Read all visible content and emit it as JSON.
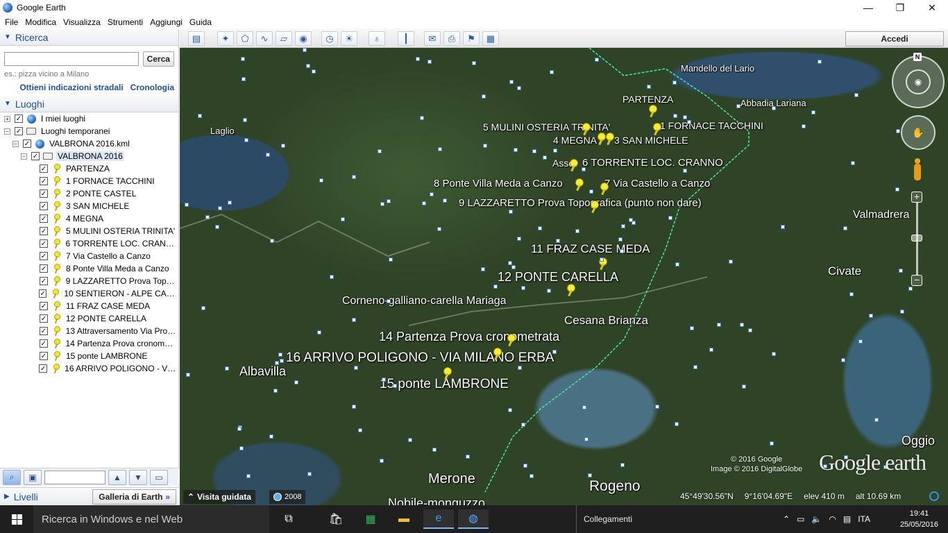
{
  "window": {
    "title": "Google Earth",
    "controls": [
      "—",
      "❐",
      "✕"
    ]
  },
  "menu": [
    "File",
    "Modifica",
    "Visualizza",
    "Strumenti",
    "Aggiungi",
    "Guida"
  ],
  "search": {
    "header": "Ricerca",
    "input_value": "",
    "button": "Cerca",
    "hint": "es.: pizza vicino a Milano",
    "link_directions": "Ottieni indicazioni stradali",
    "link_history": "Cronologia"
  },
  "places": {
    "header": "Luoghi",
    "tree": [
      {
        "label": "I miei luoghi",
        "indent": 0,
        "expander": "+",
        "icon": "globe"
      },
      {
        "label": "Luoghi temporanei",
        "indent": 0,
        "expander": "−",
        "icon": "folder"
      },
      {
        "label": "VALBRONA 2016.kml",
        "indent": 1,
        "expander": "−",
        "icon": "globe"
      },
      {
        "label": "VALBRONA 2016",
        "indent": 2,
        "expander": "−",
        "icon": "folder",
        "selected": true
      },
      {
        "label": "PARTENZA",
        "indent": 3,
        "icon": "pin"
      },
      {
        "label": "1 FORNACE TACCHINI",
        "indent": 3,
        "icon": "pin"
      },
      {
        "label": "2 PONTE CASTEL",
        "indent": 3,
        "icon": "pin"
      },
      {
        "label": "3 SAN MICHELE",
        "indent": 3,
        "icon": "pin"
      },
      {
        "label": "4 MEGNA",
        "indent": 3,
        "icon": "pin"
      },
      {
        "label": "5 MULINI OSTERIA TRINITA'",
        "indent": 3,
        "icon": "pin"
      },
      {
        "label": "6 TORRENTE LOC. CRANNO",
        "indent": 3,
        "icon": "pin"
      },
      {
        "label": "7 Via Castello a Canzo",
        "indent": 3,
        "icon": "pin"
      },
      {
        "label": "8 Ponte Villa Meda a Canzo",
        "indent": 3,
        "icon": "pin"
      },
      {
        "label": "9 LAZZARETTO Prova Topo...",
        "indent": 3,
        "icon": "pin"
      },
      {
        "label": "10 SENTIERON - ALPE CARE...",
        "indent": 3,
        "icon": "pin"
      },
      {
        "label": "11 FRAZ CASE MEDA",
        "indent": 3,
        "icon": "pin"
      },
      {
        "label": "12 PONTE CARELLA",
        "indent": 3,
        "icon": "pin"
      },
      {
        "label": "13 Attraversamento Via Prov...",
        "indent": 3,
        "icon": "pin"
      },
      {
        "label": "14 Partenza Prova cronomet...",
        "indent": 3,
        "icon": "pin"
      },
      {
        "label": "15 ponte LAMBRONE",
        "indent": 3,
        "icon": "pin"
      },
      {
        "label": "16 ARRIVO POLIGONO - VIA...",
        "indent": 3,
        "icon": "pin"
      }
    ]
  },
  "levels": {
    "header": "Livelli",
    "gallery_button": "Galleria di Earth"
  },
  "toolbar": {
    "signin": "Accedi"
  },
  "map": {
    "places": [
      {
        "text": "Mandello del Lario",
        "size": 13
      },
      {
        "text": "Abbadia Lariana",
        "size": 13
      },
      {
        "text": "Laglio",
        "size": 13
      },
      {
        "text": "Valmadrera",
        "size": 16
      },
      {
        "text": "Civate",
        "size": 17
      },
      {
        "text": "Cesana Brianza",
        "size": 17
      },
      {
        "text": "Albavilla",
        "size": 18
      },
      {
        "text": "Oggio",
        "size": 18
      },
      {
        "text": "Merone",
        "size": 20
      },
      {
        "text": "Rogeno",
        "size": 21
      },
      {
        "text": "Nobile-monguzzo",
        "size": 18
      },
      {
        "text": "Asso",
        "size": 14
      },
      {
        "text": "Corneno-galliano-carella Mariaga",
        "size": 16
      }
    ],
    "placemarks": [
      {
        "text": "PARTENZA",
        "size": 14
      },
      {
        "text": "1 FORNACE TACCHINI",
        "size": 14
      },
      {
        "text": "5 MULINI OSTERIA TRINITA'",
        "size": 14
      },
      {
        "text": "4 MEGNA",
        "size": 14
      },
      {
        "text": "3 SAN MICHELE",
        "size": 14
      },
      {
        "text": "6 TORRENTE LOC. CRANNO",
        "size": 15
      },
      {
        "text": "8 Ponte Villa Meda a Canzo",
        "size": 15
      },
      {
        "text": "7 Via Castello a Canzo",
        "size": 15
      },
      {
        "text": "9 LAZZARETTO Prova Topografica (punto non dare)",
        "size": 15
      },
      {
        "text": "11 FRAZ CASE MEDA",
        "size": 17
      },
      {
        "text": "12 PONTE CARELLA",
        "size": 18
      },
      {
        "text": "14 Partenza Prova cronometrata",
        "size": 18
      },
      {
        "text": "16 ARRIVO POLIGONO - VIA MILANO ERBA",
        "size": 19
      },
      {
        "text": "15 ponte LAMBRONE",
        "size": 19
      }
    ],
    "copyright_line1": "© 2016 Google",
    "copyright_line2": "Image © 2016 DigitalGlobe",
    "logo": "Google earth",
    "tour_button": "Visita guidata",
    "history_year": "2008",
    "north": "N"
  },
  "status": {
    "lat": "45°49'30.56\"N",
    "lon": "9°16'04.69\"E",
    "elev": "elev  410 m",
    "alt": "alt  10.69 km"
  },
  "taskbar": {
    "search_placeholder": "Ricerca in Windows e nel Web",
    "links": "Collegamenti",
    "lang": "ITA",
    "time": "19:41",
    "date": "25/05/2016"
  }
}
